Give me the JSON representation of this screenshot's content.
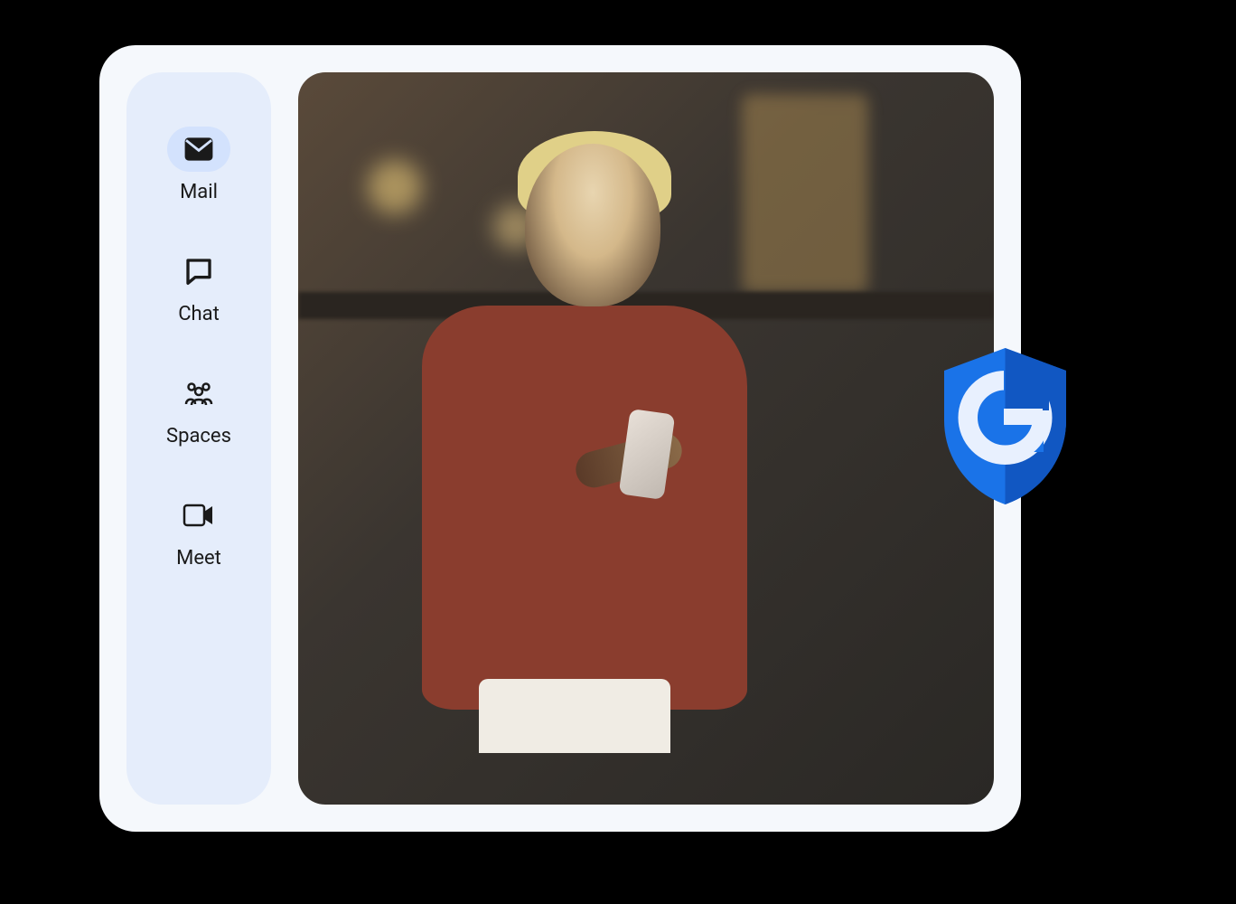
{
  "sidebar": {
    "items": [
      {
        "label": "Mail",
        "icon": "mail-icon",
        "active": true
      },
      {
        "label": "Chat",
        "icon": "chat-icon",
        "active": false
      },
      {
        "label": "Spaces",
        "icon": "spaces-icon",
        "active": false
      },
      {
        "label": "Meet",
        "icon": "meet-icon",
        "active": false
      }
    ]
  },
  "badge": {
    "letter": "G",
    "shield_color": "#1a73e8",
    "shield_dark": "#1157c2"
  },
  "colors": {
    "card_bg": "#f5f8fc",
    "sidebar_bg": "#e5edfb",
    "active_pill": "#d3e2fd"
  }
}
